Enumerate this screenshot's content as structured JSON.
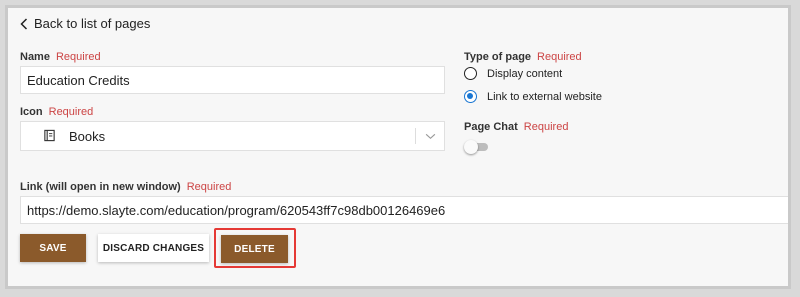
{
  "back_link": {
    "label": "Back to list of pages"
  },
  "name_field": {
    "label": "Name",
    "required": "Required",
    "value": "Education Credits"
  },
  "icon_field": {
    "label": "Icon",
    "required": "Required",
    "value": "Books",
    "icon": "books-icon"
  },
  "type_of_page": {
    "label": "Type of page",
    "required": "Required",
    "options": [
      {
        "label": "Display content",
        "selected": false
      },
      {
        "label": "Link to external website",
        "selected": true
      }
    ]
  },
  "page_chat": {
    "label": "Page Chat",
    "required": "Required",
    "enabled": false
  },
  "link_field": {
    "label": "Link (will open in new window)",
    "required": "Required",
    "value": "https://demo.slayte.com/education/program/620543ff7c98db00126469e6"
  },
  "buttons": {
    "save": "SAVE",
    "discard": "DISCARD CHANGES",
    "delete": "DELETE"
  },
  "colors": {
    "primary_button": "#8b5a2b",
    "required_text": "#cc4444",
    "radio_selected": "#1976d2",
    "highlight_border": "#e53935"
  }
}
